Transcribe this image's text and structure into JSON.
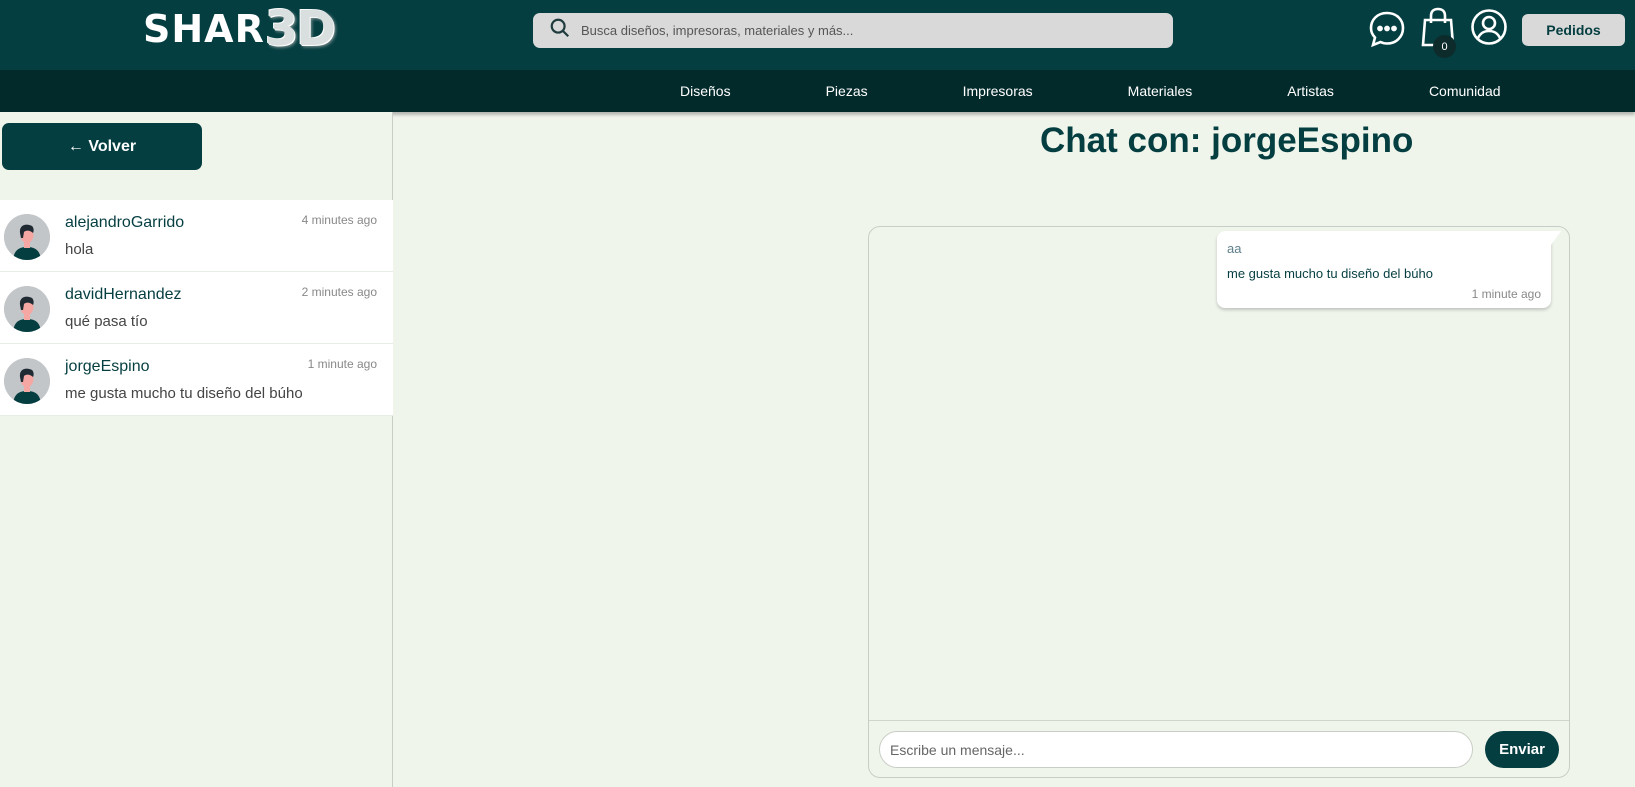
{
  "header": {
    "logo_text": "SHAR",
    "logo_3d": "3D",
    "search_placeholder": "Busca diseños, impresoras, materiales y más...",
    "cart_count": "0",
    "orders_label": "Pedidos",
    "icons": [
      "chat-icon",
      "cart-icon",
      "user-icon",
      "search-icon"
    ]
  },
  "nav": {
    "items": [
      {
        "label": "Diseños"
      },
      {
        "label": "Piezas"
      },
      {
        "label": "Impresoras"
      },
      {
        "label": "Materiales"
      },
      {
        "label": "Artistas"
      },
      {
        "label": "Comunidad"
      }
    ]
  },
  "sidebar": {
    "back_label": "← Volver",
    "conversations": [
      {
        "name": "alejandroGarrido",
        "last_message": "hola",
        "time": "4 minutes ago"
      },
      {
        "name": "davidHernandez",
        "last_message": "qué pasa tío",
        "time": "2 minutes ago"
      },
      {
        "name": "jorgeEspino",
        "last_message": "me gusta mucho tu diseño del búho",
        "time": "1 minute ago"
      }
    ]
  },
  "chat": {
    "title": "Chat con: jorgeEspino",
    "messages": [
      {
        "sender": "aa",
        "text": "me gusta mucho tu diseño del búho",
        "time": "1 minute ago"
      }
    ],
    "input_placeholder": "Escribe un mensaje...",
    "send_label": "Enviar"
  },
  "colors": {
    "primary": "#053e41",
    "nav_bg": "#032a2b",
    "page_bg": "#f0f5ec",
    "search_bg": "#d9d9d9"
  }
}
